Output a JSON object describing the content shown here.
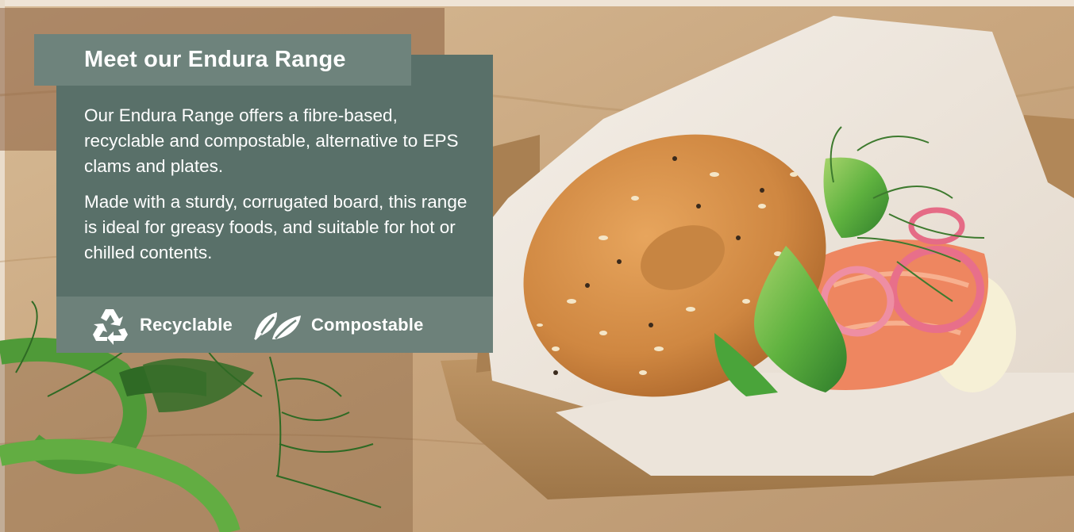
{
  "banner": {
    "title": "Meet our Endura Range",
    "paragraph_1": "Our Endura Range offers a fibre-based, recyclable and compostable, alternative to EPS clams and plates.",
    "paragraph_2": "Made with a sturdy, corrugated board, this range is ideal for greasy foods, and suitable for hot or chilled contents.",
    "features": [
      {
        "icon": "recycle-icon",
        "label": "Recyclable"
      },
      {
        "icon": "leaves-icon",
        "label": "Compostable"
      }
    ]
  },
  "photo": {
    "subject": "bagel-with-salmon-cucumber-dill-in-kraft-tray",
    "colors": {
      "wood": "#c9a77f",
      "tray": "#b58a5c",
      "bagel": "#cf8a45",
      "cucumber": "#3f9b3a",
      "salmon": "#ef8a62"
    }
  },
  "colors": {
    "panel": "#597069",
    "title_tab": "#6e837c",
    "features_bar": "#6d817a",
    "text": "#ffffff"
  }
}
